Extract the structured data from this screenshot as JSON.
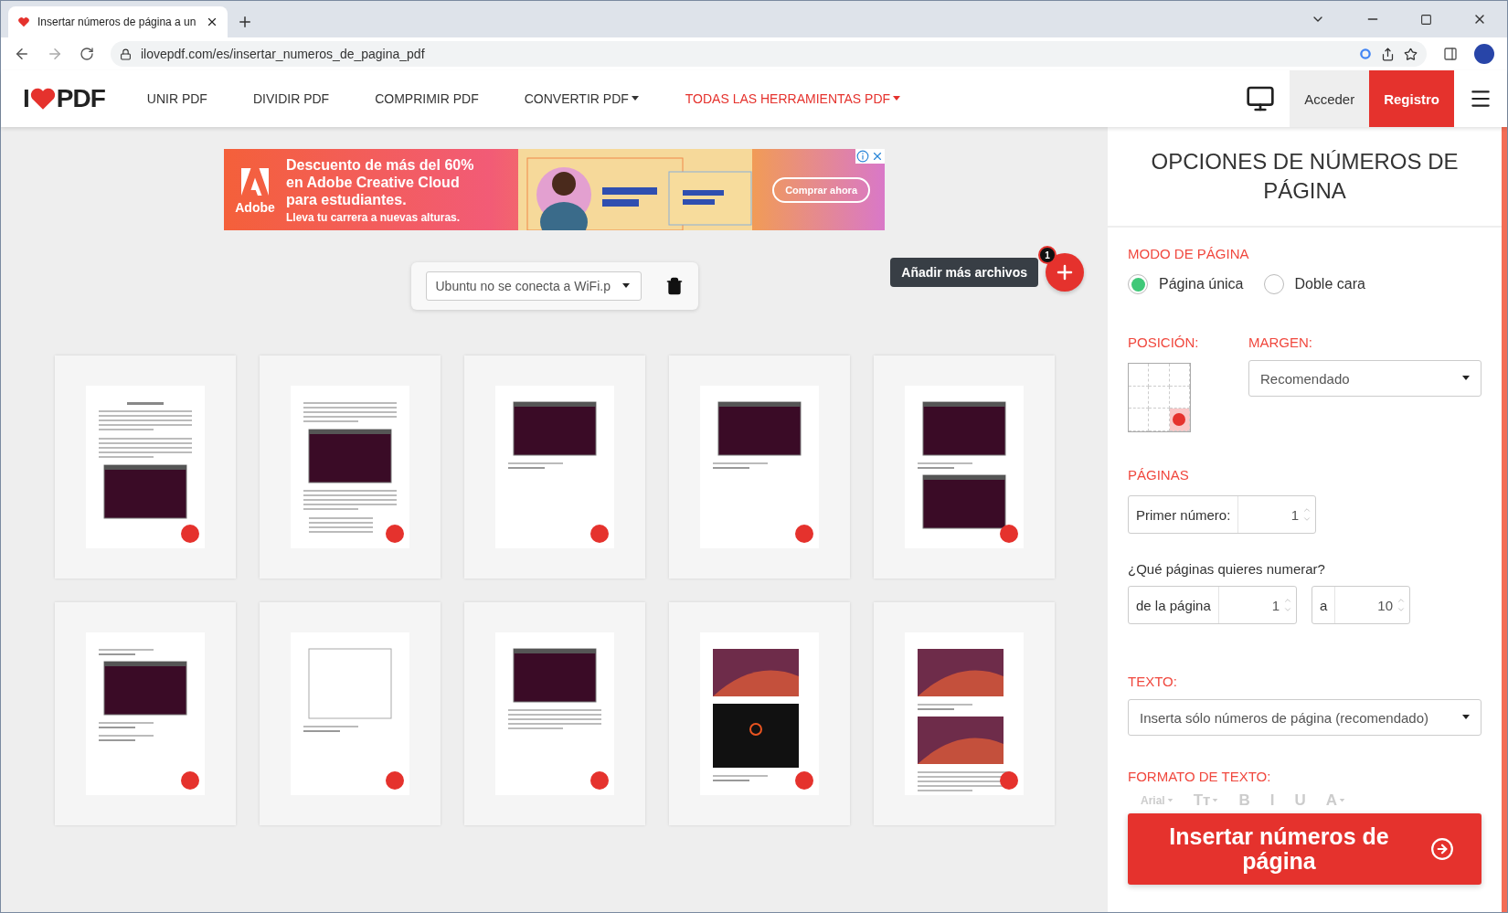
{
  "browser": {
    "tab": {
      "title": "Insertar números de página a un"
    },
    "url": "ilovepdf.com/es/insertar_numeros_de_pagina_pdf"
  },
  "header": {
    "logo": {
      "left": "I",
      "right": "PDF"
    },
    "nav": [
      {
        "label": "UNIR PDF",
        "dropdown": false,
        "highlighted": false
      },
      {
        "label": "DIVIDIR PDF",
        "dropdown": false,
        "highlighted": false
      },
      {
        "label": "COMPRIMIR PDF",
        "dropdown": false,
        "highlighted": false
      },
      {
        "label": "CONVERTIR PDF",
        "dropdown": true,
        "highlighted": false
      },
      {
        "label": "TODAS LAS HERRAMIENTAS PDF",
        "dropdown": true,
        "highlighted": true
      }
    ],
    "login": "Acceder",
    "register": "Registro"
  },
  "ad": {
    "brand": "Adobe",
    "headline": [
      "Descuento de más del 60%",
      "en Adobe Creative Cloud",
      "para estudiantes."
    ],
    "tagline": "Lleva tu carrera a nuevas alturas.",
    "cta": "Comprar ahora"
  },
  "file_bar": {
    "file": "Ubuntu no se conecta a WiFi.p"
  },
  "add_files": {
    "tooltip": "Añadir más archivos",
    "count": "1"
  },
  "pages": [
    {
      "blocks": [
        {
          "kind": "title"
        },
        {
          "kind": "text"
        },
        {
          "kind": "text"
        },
        {
          "kind": "terminal"
        }
      ]
    },
    {
      "blocks": [
        {
          "kind": "text"
        },
        {
          "kind": "terminal"
        },
        {
          "kind": "text"
        },
        {
          "kind": "list"
        }
      ]
    },
    {
      "blocks": [
        {
          "kind": "terminal"
        },
        {
          "kind": "short"
        }
      ]
    },
    {
      "blocks": [
        {
          "kind": "terminal"
        },
        {
          "kind": "short"
        }
      ]
    },
    {
      "blocks": [
        {
          "kind": "terminal"
        },
        {
          "kind": "short"
        },
        {
          "kind": "terminal"
        }
      ]
    },
    {
      "blocks": [
        {
          "kind": "short"
        },
        {
          "kind": "terminal"
        },
        {
          "kind": "short"
        },
        {
          "kind": "short"
        }
      ]
    },
    {
      "blocks": [
        {
          "kind": "window"
        },
        {
          "kind": "short"
        }
      ]
    },
    {
      "blocks": [
        {
          "kind": "terminal"
        },
        {
          "kind": "text"
        }
      ]
    },
    {
      "blocks": [
        {
          "kind": "desktop"
        },
        {
          "kind": "boot"
        },
        {
          "kind": "short"
        }
      ]
    },
    {
      "blocks": [
        {
          "kind": "desktop"
        },
        {
          "kind": "short"
        },
        {
          "kind": "desktop"
        },
        {
          "kind": "text"
        }
      ]
    }
  ],
  "panel": {
    "title": "OPCIONES DE NÚMEROS DE PÁGINA",
    "page_mode": {
      "label": "MODO DE PÁGINA",
      "options": [
        {
          "label": "Página única",
          "selected": true
        },
        {
          "label": "Doble cara",
          "selected": false
        }
      ]
    },
    "position": {
      "label": "POSICIÓN:",
      "cells": [
        {
          "selected": false
        },
        {
          "selected": false
        },
        {
          "selected": false
        },
        {
          "selected": false
        },
        {
          "selected": false
        },
        {
          "selected": false
        },
        {
          "selected": false
        },
        {
          "selected": false
        },
        {
          "selected": true
        }
      ]
    },
    "margin": {
      "label": "MARGEN:",
      "value": "Recomendado"
    },
    "pages": {
      "label": "PÁGINAS",
      "first_number": {
        "label": "Primer número:",
        "value": "1"
      },
      "question": "¿Qué páginas quieres numerar?",
      "from": {
        "label": "de la página",
        "value": "1"
      },
      "to": {
        "label": "a",
        "value": "10"
      }
    },
    "text": {
      "label": "TEXTO:",
      "value": "Inserta sólo números de página (recomendado)"
    },
    "format": {
      "label": "FORMATO DE TEXTO:",
      "disabled": true,
      "tools": [
        {
          "label": "Arial",
          "dropdown": true
        },
        {
          "label": "Tт",
          "dropdown": true
        },
        {
          "label": "B",
          "dropdown": false
        },
        {
          "label": "I",
          "dropdown": false
        },
        {
          "label": "U",
          "dropdown": false
        },
        {
          "label": "A",
          "dropdown": true
        }
      ]
    },
    "submit": "Insertar números de página"
  }
}
